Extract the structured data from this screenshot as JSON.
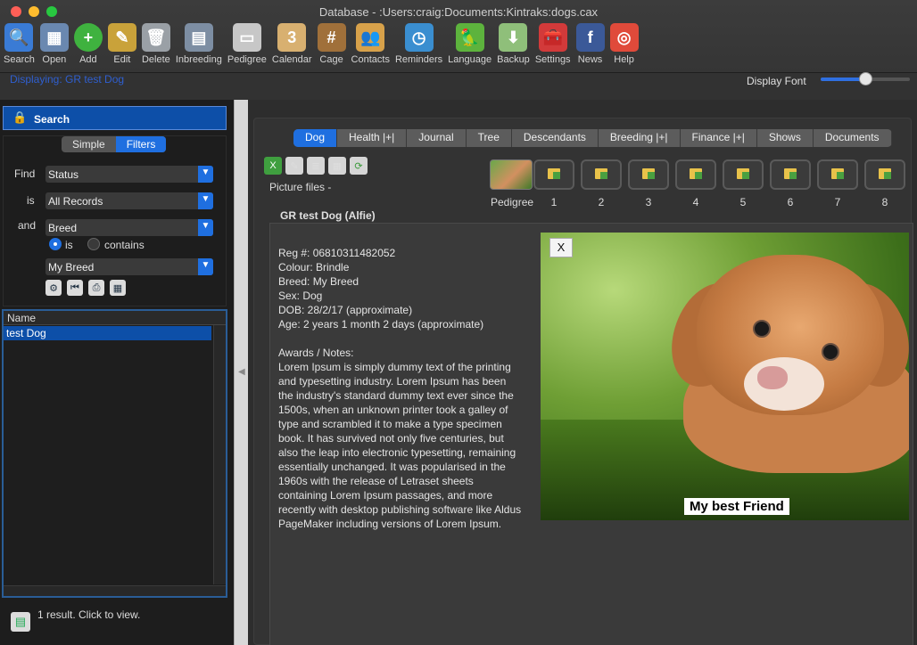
{
  "window": {
    "title": "Database - :Users:craig:Documents:Kintraks:dogs.cax"
  },
  "toolbar": [
    {
      "label": "Search",
      "icon": "magnifier-icon",
      "color": "#3a7bd5"
    },
    {
      "label": "Open",
      "icon": "table-icon",
      "color": "#6a88b0"
    },
    {
      "label": "Add",
      "icon": "plus-icon",
      "color": "#3fb23f"
    },
    {
      "label": "Edit",
      "icon": "pencil-icon",
      "color": "#c9a23a"
    },
    {
      "label": "Delete",
      "icon": "trash-icon",
      "color": "#9aa0a6"
    },
    {
      "label": "Inbreeding",
      "icon": "calculator-icon",
      "color": "#7d8ea3"
    },
    {
      "label": "Pedigree",
      "icon": "certificate-icon",
      "color": "#c7c7c7"
    },
    {
      "label": "Calendar",
      "icon": "calendar-icon",
      "color": "#d8b070"
    },
    {
      "label": "Cage",
      "icon": "cage-icon",
      "color": "#a0703a"
    },
    {
      "label": "Contacts",
      "icon": "people-icon",
      "color": "#d7a14a"
    },
    {
      "label": "Reminders",
      "icon": "clock-icon",
      "color": "#3a8ed0"
    },
    {
      "label": "Language",
      "icon": "parrot-icon",
      "color": "#5db33d"
    },
    {
      "label": "Backup",
      "icon": "download-icon",
      "color": "#8fbf7a"
    },
    {
      "label": "Settings",
      "icon": "toolbox-icon",
      "color": "#d23a3a"
    },
    {
      "label": "News",
      "icon": "facebook-icon",
      "color": "#3b5998"
    },
    {
      "label": "Help",
      "icon": "lifebuoy-icon",
      "color": "#e04a3a"
    }
  ],
  "status": {
    "displaying": "Displaying: GR test Dog",
    "display_font_label": "Display Font",
    "display_font_value": 0.5
  },
  "search": {
    "header": "Search",
    "modes": [
      "Simple",
      "Filters"
    ],
    "selected_mode": "Filters",
    "find_label": "Find",
    "find_value": "Status",
    "is_label": "is",
    "is_value": "All Records",
    "and_label": "and",
    "and_value": "Breed",
    "radio_is": "is",
    "radio_contains": "contains",
    "breed_value": "My Breed"
  },
  "results": {
    "column": "Name",
    "rows": [
      "test Dog"
    ],
    "summary": "1 result. Click to view."
  },
  "tabs": [
    "Dog",
    "Health |+|",
    "Journal",
    "Tree",
    "Descendants",
    "Breeding |+|",
    "Finance |+|",
    "Shows",
    "Documents"
  ],
  "selected_tab": "Dog",
  "pictures": {
    "label": "Picture files -",
    "pedigree_label": "Pedigree",
    "slots": [
      "1",
      "2",
      "3",
      "4",
      "5",
      "6",
      "7",
      "8"
    ]
  },
  "dog": {
    "name": "GR test Dog  (Alfie)",
    "reg": "Reg #: 06810311482052",
    "colour": "Colour: Brindle",
    "breed": "Breed: My Breed",
    "sex": "Sex: Dog",
    "dob": "DOB:  28/2/17 (approximate)",
    "age": "Age: 2 years 1 month  2 days (approximate)",
    "notes_label": "Awards / Notes:",
    "notes": "Lorem Ipsum is simply dummy text of the printing and typesetting industry. Lorem Ipsum has been the industry's standard dummy text ever since the 1500s, when an unknown printer took a galley of type and scrambled it to make a type specimen book. It has survived not only five centuries, but also the leap into electronic typesetting, remaining essentially unchanged. It was popularised in the 1960s with the release of Letraset sheets containing Lorem Ipsum passages, and more recently with desktop publishing software like Aldus PageMaker including versions of Lorem Ipsum.",
    "photo_close": "X",
    "photo_caption": "My best Friend"
  }
}
